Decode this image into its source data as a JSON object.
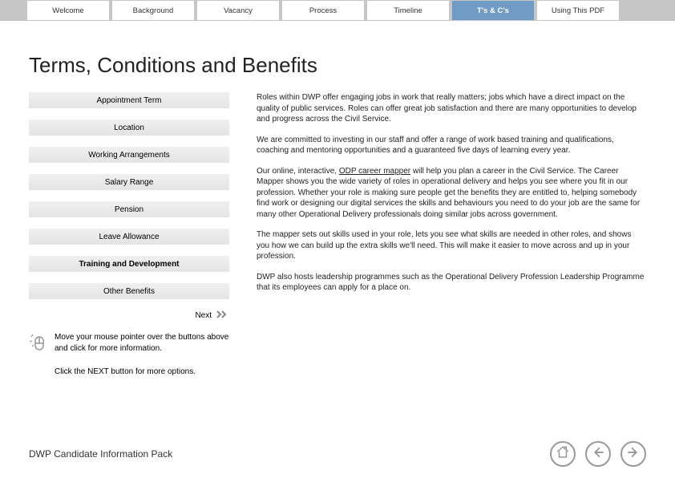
{
  "tabs": [
    {
      "label": "Welcome"
    },
    {
      "label": "Background"
    },
    {
      "label": "Vacancy"
    },
    {
      "label": "Process"
    },
    {
      "label": "Timeline"
    },
    {
      "label": "T's & C's",
      "active": true
    },
    {
      "label": "Using This PDF"
    }
  ],
  "title": "Terms, Conditions and Benefits",
  "sections": [
    {
      "label": "Appointment Term"
    },
    {
      "label": "Location"
    },
    {
      "label": "Working Arrangements"
    },
    {
      "label": "Salary Range"
    },
    {
      "label": "Pension"
    },
    {
      "label": "Leave Allowance"
    },
    {
      "label": "Training and Development",
      "active": true
    },
    {
      "label": "Other Benefits"
    }
  ],
  "next_label": "Next",
  "hints": {
    "h1": "Move your mouse pointer over the buttons above and click for more information.",
    "h2": "Click the NEXT button for more options."
  },
  "body": {
    "p1": "Roles within DWP offer engaging jobs in work that really matters; jobs which have a direct impact on the quality of public services. Roles can offer great job satisfaction and there are many opportunities to develop and progress across the Civil Service.",
    "p2": "We are committed to investing in our staff and offer a range of work based training and qualifications, coaching and mentoring opportunities and a guaranteed five days of learning every year.",
    "p3a": "Our online, interactive, ",
    "p3link": "ODP career mapper",
    "p3b": " will help you plan a career in the Civil Service. The Career Mapper shows you the wide variety of roles in operational delivery and helps you see where you fit in our profession. Whether your role is making sure people get the benefits they are entitled to, helping somebody find work or designing our digital services the skills and behaviours you need to do your job are the same for many other Operational Delivery professionals doing similar jobs across government.",
    "p4": "The mapper sets out skills used in your role, lets you see what skills are needed in other roles, and shows you how we can build up the extra skills we'll need. This will make it easier to move across and up in your profession.",
    "p5": "DWP also hosts leadership programmes such as the Operational Delivery Profession Leadership Programme that its employees can apply for a place on."
  },
  "footer_text": "DWP Candidate Information Pack"
}
